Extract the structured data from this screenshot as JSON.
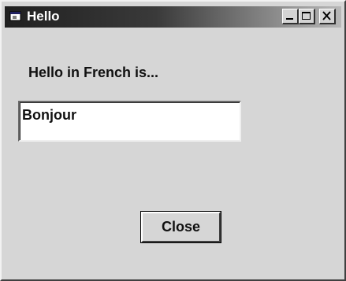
{
  "window": {
    "title": "Hello",
    "icon": "app-window-icon",
    "controls": {
      "minimize_icon": "minimize-icon",
      "maximize_icon": "maximize-icon",
      "close_icon": "close-icon"
    }
  },
  "content": {
    "prompt_label": "Hello in French is...",
    "translation_value": "Bonjour",
    "close_button_label": "Close"
  },
  "colors": {
    "face": "#d6d6d6",
    "title_start": "#202020",
    "title_end": "#b8b8b8",
    "title_text": "#ffffff"
  }
}
